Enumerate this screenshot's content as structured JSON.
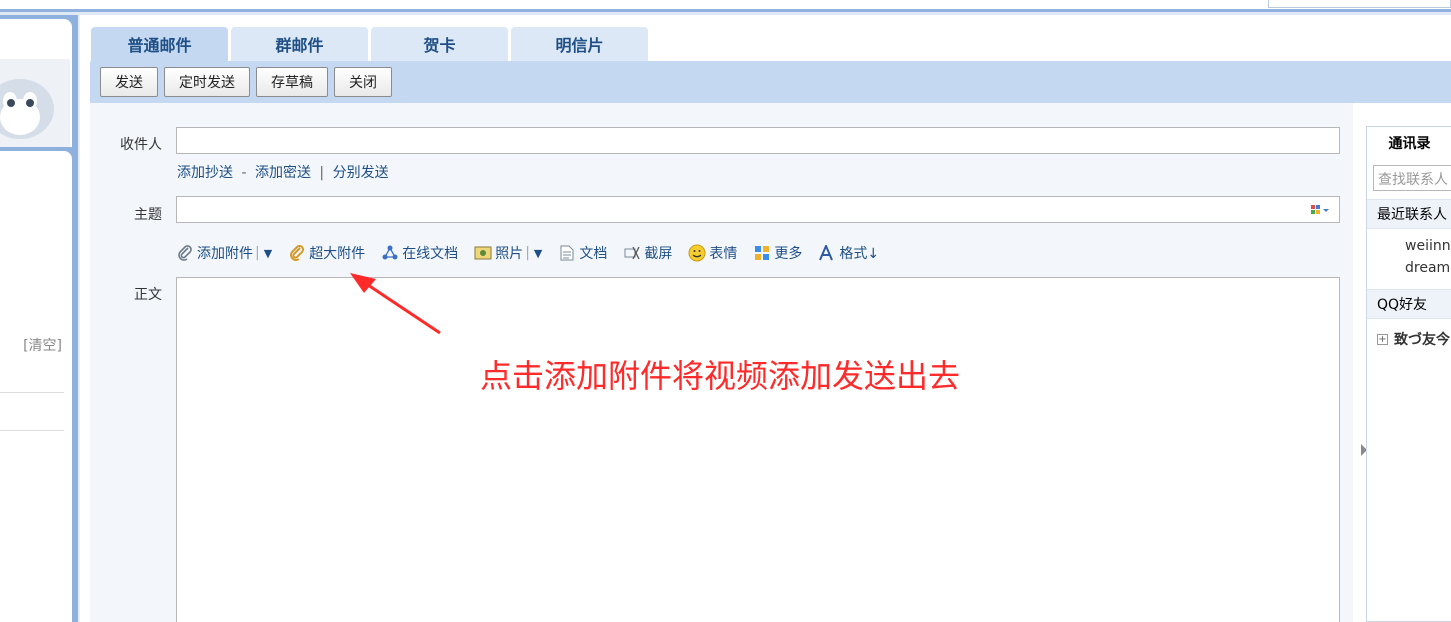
{
  "tabs": [
    "普通邮件",
    "群邮件",
    "贺卡",
    "明信片"
  ],
  "toolbar": {
    "send": "发送",
    "timed_send": "定时发送",
    "save_draft": "存草稿",
    "close": "关闭"
  },
  "left": {
    "clear": "[清空]"
  },
  "compose": {
    "to_label": "收件人",
    "cc_links": {
      "add_cc": "添加抄送",
      "dash": "-",
      "add_bcc": "添加密送",
      "bar": "|",
      "separate_send": "分别发送"
    },
    "subject_label": "主题",
    "body_label": "正文"
  },
  "attach_bar": {
    "add_attachment": "添加附件",
    "large_attachment": "超大附件",
    "online_doc": "在线文档",
    "photo": "照片",
    "document": "文档",
    "screenshot": "截屏",
    "emoji": "表情",
    "more": "更多",
    "format": "格式↓"
  },
  "annotation": "点击添加附件将视频添加发送出去",
  "contacts": {
    "title": "通讯录",
    "search_placeholder": "查找联系人",
    "recent": "最近联系人",
    "recent_entries": [
      "weiinn",
      "dream"
    ],
    "qq_friends": "QQ好友",
    "group": "致づ友今"
  },
  "colors": {
    "accent": "#8eb1de",
    "toolbar": "#c4d9f1",
    "link": "#1f4f86",
    "annotation": "#ff2a2a"
  }
}
